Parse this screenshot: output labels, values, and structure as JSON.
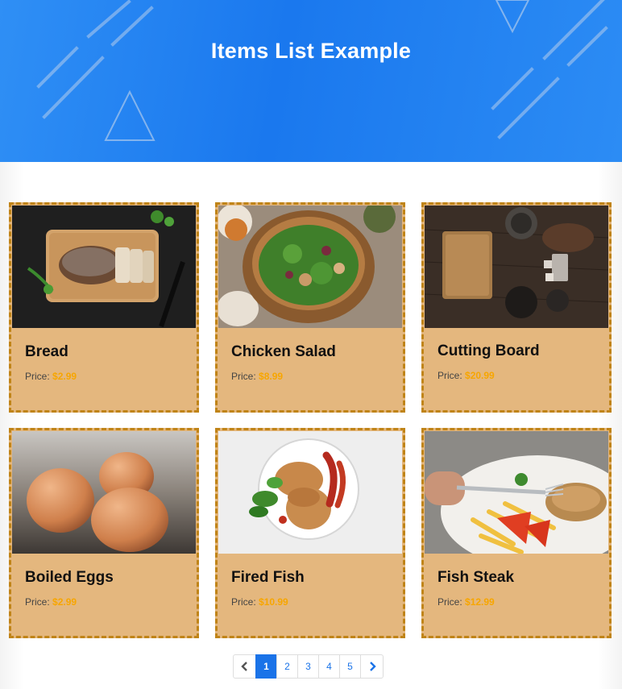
{
  "header": {
    "title": "Items List Example"
  },
  "price_label": "Price:",
  "items": [
    {
      "name": "Bread",
      "price": "$2.99",
      "image": "bread-photo"
    },
    {
      "name": "Chicken Salad",
      "price": "$8.99",
      "image": "chicken-salad-photo"
    },
    {
      "name": "Cutting Board",
      "price": "$20.99",
      "image": "cutting-board-photo"
    },
    {
      "name": "Boiled Eggs",
      "price": "$2.99",
      "image": "boiled-eggs-photo"
    },
    {
      "name": "Fired Fish",
      "price": "$10.99",
      "image": "fried-fish-photo"
    },
    {
      "name": "Fish Steak",
      "price": "$12.99",
      "image": "fish-steak-photo"
    }
  ],
  "pagination": {
    "prev_icon": "chevron-left-icon",
    "next_icon": "chevron-right-icon",
    "pages": [
      "1",
      "2",
      "3",
      "4",
      "5"
    ],
    "active_page": "1"
  },
  "colors": {
    "header_blue": "#1a78ee",
    "card_bg": "#e4b77e",
    "card_border": "#c08418",
    "price_color": "#f7a600",
    "active_page": "#1a73e8"
  }
}
